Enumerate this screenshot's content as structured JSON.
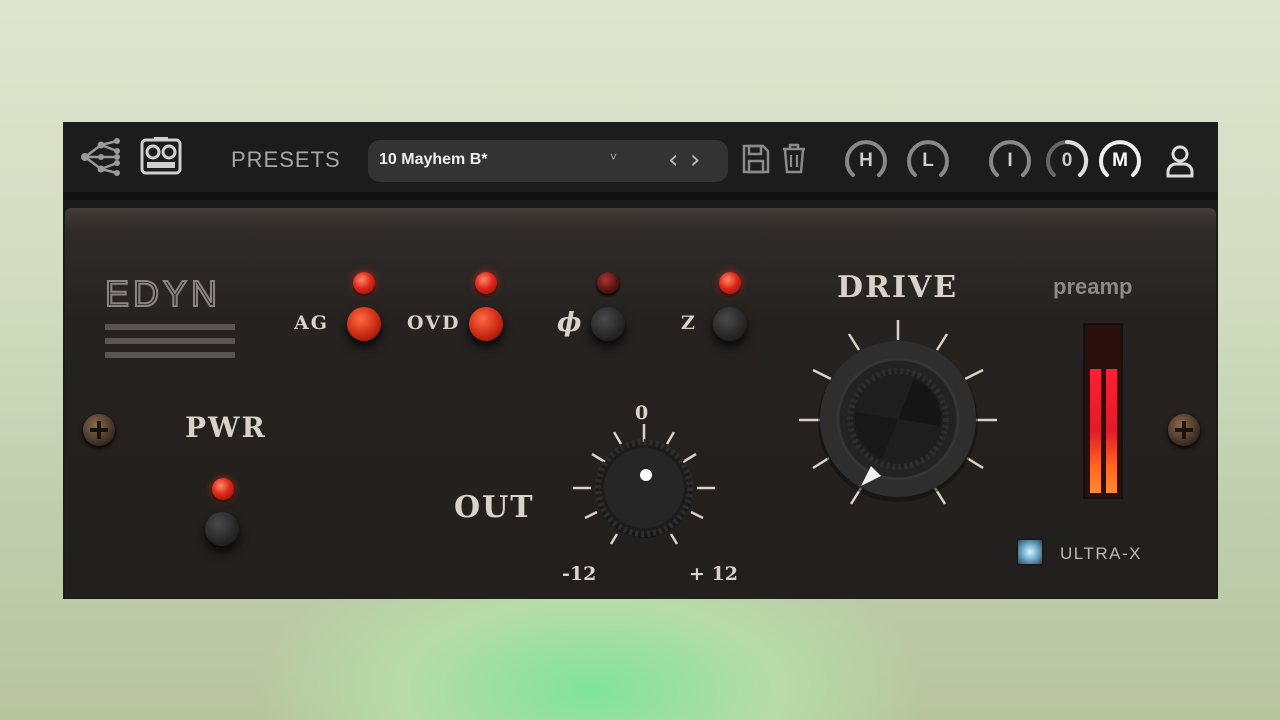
{
  "toolbar": {
    "presets_label": "PRESETS",
    "preset_name": "10 Mayhem B*",
    "preset_caret": "˅",
    "prev_symbol": "‹",
    "next_symbol": "›",
    "ring_buttons": [
      {
        "label": "H"
      },
      {
        "label": "L"
      },
      {
        "label": "I"
      },
      {
        "label": "0"
      },
      {
        "label": "M"
      }
    ],
    "icons": [
      "share-icon",
      "tape-machine-icon",
      "save-icon",
      "trash-icon",
      "user-icon"
    ]
  },
  "panel": {
    "logo": "EDYN",
    "pwr_label": "PWR",
    "switches": [
      {
        "label": "AG",
        "led": "on",
        "button": "red"
      },
      {
        "label": "OVD",
        "led": "on",
        "button": "red"
      },
      {
        "label": "ϕ",
        "led": "off",
        "button": "dark"
      },
      {
        "label": "Z",
        "led": "on",
        "button": "dark"
      }
    ],
    "out": {
      "label": "OUT",
      "scale_top": "0",
      "scale_min": "-12",
      "scale_max": "+ 12",
      "value": 0
    },
    "drive": {
      "label": "DRIVE"
    },
    "preamp_label": "preamp",
    "meter": {
      "left_level": 0.75,
      "right_level": 0.75
    },
    "ultrax_label": "ULTRA-X"
  },
  "colors": {
    "led_red": "#e0281a",
    "panel_bg": "#221f1d",
    "topbar_bg": "#1c1c1c",
    "meter_red": "#ff2035",
    "ultrax_blue": "#7ab9d6"
  }
}
